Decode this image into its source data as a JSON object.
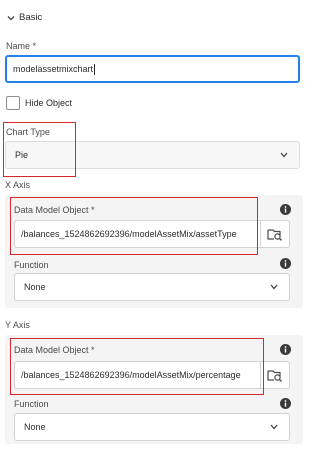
{
  "section": {
    "title": "Basic"
  },
  "name_field": {
    "label": "Name *",
    "value": "modelassetmixchart"
  },
  "hide_object": {
    "label": "Hide Object",
    "checked": false
  },
  "chart_type": {
    "label": "Chart Type",
    "value": "Pie"
  },
  "x_axis": {
    "heading": "X Axis",
    "data_model_object": {
      "label": "Data Model Object *",
      "value": "/balances_1524862692396/modelAssetMix/assetType"
    },
    "function": {
      "label": "Function",
      "value": "None"
    }
  },
  "y_axis": {
    "heading": "Y Axis",
    "data_model_object": {
      "label": "Data Model Object *",
      "value": "/balances_1524862692396/modelAssetMix/percentage"
    },
    "function": {
      "label": "Function",
      "value": "None"
    }
  },
  "colors": {
    "highlight_border": "#d9262c",
    "focus_border": "#2680eb",
    "group_background": "#f4f4f4"
  },
  "icons": [
    "chevron-down-icon",
    "info-icon",
    "browse-data-icon"
  ]
}
